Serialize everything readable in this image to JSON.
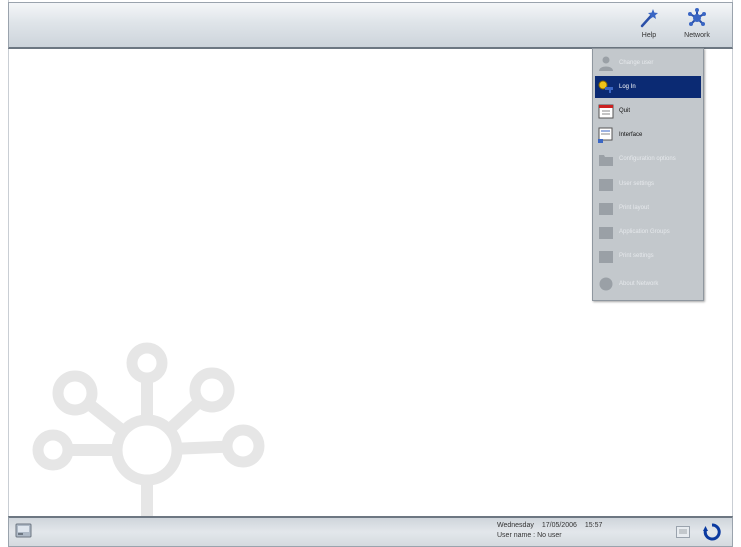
{
  "toolbar": {
    "buttons": [
      {
        "icon": "wand-icon",
        "label": "Help"
      },
      {
        "icon": "network-icon",
        "label": "Network"
      }
    ]
  },
  "menu": {
    "items": [
      {
        "icon": "user-icon",
        "label": "Change user",
        "state": "disabled"
      },
      {
        "icon": "key-icon",
        "label": "Log In",
        "state": "selected"
      },
      {
        "icon": "calendar-icon",
        "label": "Quit",
        "state": "enabled"
      },
      {
        "icon": "document-icon",
        "label": "Interface",
        "state": "enabled"
      },
      {
        "icon": "folder-icon",
        "label": "Configuration options",
        "state": "disabled"
      },
      {
        "icon": "folder-icon",
        "label": "User settings",
        "state": "disabled"
      },
      {
        "icon": "folder-icon",
        "label": "Print layout",
        "state": "disabled"
      },
      {
        "icon": "folder-icon",
        "label": "Application Groups",
        "state": "disabled"
      },
      {
        "icon": "folder-icon",
        "label": "Print settings",
        "state": "disabled"
      },
      {
        "icon": "globe-icon",
        "label": "About Network",
        "state": "disabled"
      }
    ]
  },
  "status": {
    "day": "Wednesday",
    "date": "17/05/2006",
    "time": "15:57",
    "user_line": "User name : No user"
  },
  "colors": {
    "selection": "#0b2a73",
    "menu_bg": "#c3c8cc",
    "logo": "#e6e6e6"
  }
}
